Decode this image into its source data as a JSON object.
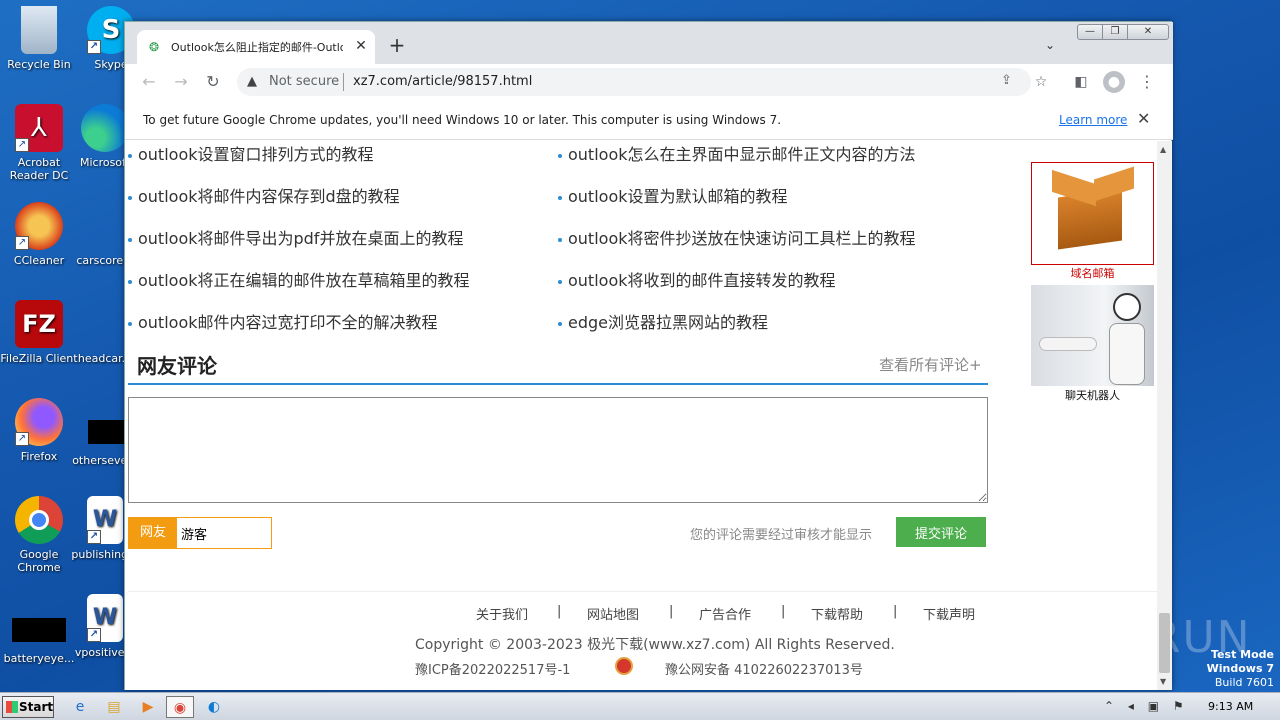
{
  "desktop": {
    "icons": [
      {
        "label": "Recycle Bin"
      },
      {
        "label": "Skype"
      },
      {
        "label": "Acrobat Reader DC"
      },
      {
        "label": "Microsoft"
      },
      {
        "label": "CCleaner"
      },
      {
        "label": "carscore..."
      },
      {
        "label": "FileZilla Client"
      },
      {
        "label": "headcar..."
      },
      {
        "label": "Firefox"
      },
      {
        "label": "otherseve..."
      },
      {
        "label": "Google Chrome"
      },
      {
        "label": "publishing..."
      },
      {
        "label": "batteryeye..."
      },
      {
        "label": "vpositive..."
      }
    ],
    "watermark": "ANY RUN",
    "testmode": {
      "line1": "Test Mode",
      "line2": "Windows 7",
      "line3": "Build 7601"
    }
  },
  "browser": {
    "tab_title": "Outlook怎么阻止指定的邮件-Outlook",
    "security_label": "Not secure",
    "url": "xz7.com/article/98157.html",
    "infobar_message": "To get future Google Chrome updates, you'll need Windows 10 or later. This computer is using Windows 7.",
    "infobar_link": "Learn more"
  },
  "page": {
    "articles": [
      {
        "title": "outlook设置窗口排列方式的教程"
      },
      {
        "title": "outlook怎么在主界面中显示邮件正文内容的方法"
      },
      {
        "title": "outlook将邮件内容保存到d盘的教程"
      },
      {
        "title": "outlook设置为默认邮箱的教程"
      },
      {
        "title": "outlook将邮件导出为pdf并放在桌面上的教程"
      },
      {
        "title": "outlook将密件抄送放在快速访问工具栏上的教程"
      },
      {
        "title": "outlook将正在编辑的邮件放在草稿箱里的教程"
      },
      {
        "title": "outlook将收到的邮件直接转发的教程"
      },
      {
        "title": "outlook邮件内容过宽打印不全的解决教程"
      },
      {
        "title": "edge浏览器拉黑网站的教程"
      }
    ],
    "comments": {
      "title": "网友评论",
      "view_all": "查看所有评论+",
      "textarea_value": "",
      "nick_label": "网友",
      "nick_value": "游客",
      "review_note": "您的评论需要经过审核才能显示",
      "submit_label": "提交评论"
    },
    "footer": {
      "links": [
        "关于我们",
        "网站地图",
        "广告合作",
        "下载帮助",
        "下载声明"
      ],
      "separator": "|",
      "copyright": "Copyright © 2003-2023 极光下载(www.xz7.com) All Rights Reserved.",
      "icp": "豫ICP备2022022517号-1",
      "police": "豫公网安备 41022602237013号"
    },
    "ads": [
      {
        "caption": "域名邮箱"
      },
      {
        "caption": "聊天机器人"
      }
    ]
  },
  "taskbar": {
    "start_label": "Start",
    "clock": "9:13 AM"
  }
}
